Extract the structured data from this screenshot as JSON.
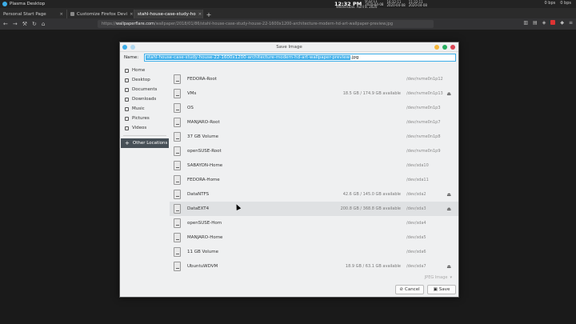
{
  "panel": {
    "app_title": "Plasma Desktop",
    "clock_time": "12:32 PM",
    "clock_date": "Wednesday, April 8, 2020",
    "clock2_time": "9:32:11",
    "clock2_date": "2020-04-08",
    "clock3_time": "16:32:11",
    "clock3_date": "2020-04-08",
    "clock4_time": "11:32:11",
    "clock4_date": "2020-04-08",
    "net_down": "0 bps",
    "net_up": "0 bps"
  },
  "browser": {
    "tabs": [
      {
        "label": "Personal Start Page"
      },
      {
        "label": "Customize Firefox Devi"
      },
      {
        "label": "stahl-house-case-study-ho"
      }
    ],
    "new_tab_label": "+",
    "url_prefix": "https://",
    "url_domain": "wallpaperflare.com",
    "url_rest": "/wallpaper/2018/01/86/stahl-house-case-study-house-22-1600x1200-architecture-modern-hd-art-wallpaper-preview.jpg"
  },
  "dialog": {
    "title": "Save Image",
    "name_label": "Name:",
    "filename_selected": "stahl-house-case-study-house-22-1600x1200-architecture-modern-hd-art-wallpaper-preview",
    "filename_ext": ".jpg",
    "sidebar": [
      {
        "label": "Home",
        "icon": "home-icon"
      },
      {
        "label": "Desktop",
        "icon": "desktop-icon"
      },
      {
        "label": "Documents",
        "icon": "documents-icon"
      },
      {
        "label": "Downloads",
        "icon": "downloads-icon"
      },
      {
        "label": "Music",
        "icon": "music-icon"
      },
      {
        "label": "Pictures",
        "icon": "pictures-icon"
      },
      {
        "label": "Videos",
        "icon": "videos-icon"
      }
    ],
    "other_locations": "Other Locations",
    "volumes": [
      {
        "name": "FEDORA-Root",
        "size": "",
        "device": "/dev/nvme0n1p12",
        "eject": false
      },
      {
        "name": "VMs",
        "size": "18.5 GB / 174.9 GB available",
        "device": "/dev/nvme0n1p13",
        "eject": true
      },
      {
        "name": "OS",
        "size": "",
        "device": "/dev/nvme0n1p3",
        "eject": false
      },
      {
        "name": "MANJARO-Root",
        "size": "",
        "device": "/dev/nvme0n1p7",
        "eject": false
      },
      {
        "name": "37 GB Volume",
        "size": "",
        "device": "/dev/nvme0n1p8",
        "eject": false
      },
      {
        "name": "openSUSE-Root",
        "size": "",
        "device": "/dev/nvme0n1p9",
        "eject": false
      },
      {
        "name": "SABAYON-Home",
        "size": "",
        "device": "/dev/sda10",
        "eject": false
      },
      {
        "name": "FEDORA-Home",
        "size": "",
        "device": "/dev/sda11",
        "eject": false
      },
      {
        "name": "DataNTFS",
        "size": "42.6 GB / 145.0 GB available",
        "device": "/dev/sda2",
        "eject": true
      },
      {
        "name": "DataEXT4",
        "size": "200.8 GB / 368.8 GB available",
        "device": "/dev/sda3",
        "eject": true
      },
      {
        "name": "openSUSE-Hom",
        "size": "",
        "device": "/dev/sda4",
        "eject": false
      },
      {
        "name": "MANJARO-Home",
        "size": "",
        "device": "/dev/sda5",
        "eject": false
      },
      {
        "name": "11 GB Volume",
        "size": "",
        "device": "/dev/sda6",
        "eject": false
      },
      {
        "name": "UbuntuWDVM",
        "size": "18.9 GB / 63.1 GB available",
        "device": "/dev/sda7",
        "eject": true
      }
    ],
    "filter_label": "JPEG Image",
    "cancel_label": "Cancel",
    "save_label": "Save"
  }
}
